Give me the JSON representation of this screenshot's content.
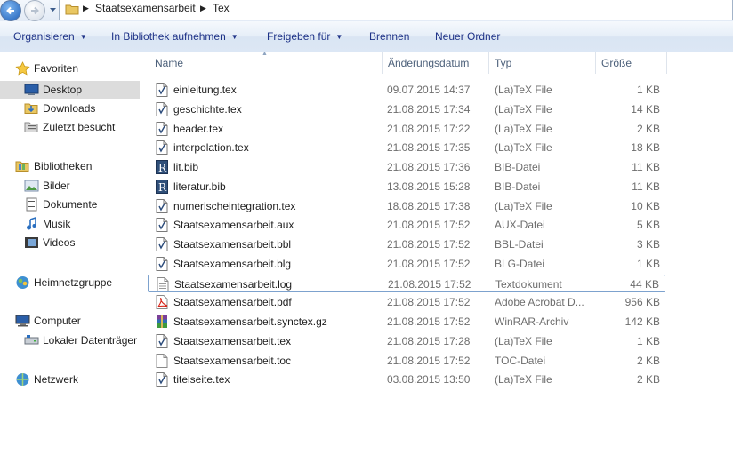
{
  "address": {
    "crumbs": [
      "Staatsexamensarbeit",
      "Tex"
    ]
  },
  "toolbar": {
    "organize": "Organisieren",
    "include_library": "In Bibliothek aufnehmen",
    "share": "Freigeben für",
    "burn": "Brennen",
    "new_folder": "Neuer Ordner"
  },
  "nav": {
    "favorites": "Favoriten",
    "desktop": "Desktop",
    "downloads": "Downloads",
    "recent": "Zuletzt besucht",
    "libraries": "Bibliotheken",
    "pictures": "Bilder",
    "documents": "Dokumente",
    "music": "Musik",
    "videos": "Videos",
    "homegroup": "Heimnetzgruppe",
    "computer": "Computer",
    "local_disk": "Lokaler Datenträger",
    "network": "Netzwerk"
  },
  "columns": {
    "name": "Name",
    "date": "Änderungsdatum",
    "type": "Typ",
    "size": "Größe"
  },
  "files": [
    {
      "name": "einleitung.tex",
      "date": "09.07.2015 14:37",
      "type": "(La)TeX File",
      "size": "1 KB",
      "icon": "tex-file-icon"
    },
    {
      "name": "geschichte.tex",
      "date": "21.08.2015 17:34",
      "type": "(La)TeX File",
      "size": "14 KB",
      "icon": "tex-file-icon"
    },
    {
      "name": "header.tex",
      "date": "21.08.2015 17:22",
      "type": "(La)TeX File",
      "size": "2 KB",
      "icon": "tex-file-icon"
    },
    {
      "name": "interpolation.tex",
      "date": "21.08.2015 17:35",
      "type": "(La)TeX File",
      "size": "18 KB",
      "icon": "tex-file-icon"
    },
    {
      "name": "lit.bib",
      "date": "21.08.2015 17:36",
      "type": "BIB-Datei",
      "size": "11 KB",
      "icon": "bib-file-icon"
    },
    {
      "name": "literatur.bib",
      "date": "13.08.2015 15:28",
      "type": "BIB-Datei",
      "size": "11 KB",
      "icon": "bib-file-icon"
    },
    {
      "name": "numerischeintegration.tex",
      "date": "18.08.2015 17:38",
      "type": "(La)TeX File",
      "size": "10 KB",
      "icon": "tex-file-icon"
    },
    {
      "name": "Staatsexamensarbeit.aux",
      "date": "21.08.2015 17:52",
      "type": "AUX-Datei",
      "size": "5 KB",
      "icon": "tex-file-icon"
    },
    {
      "name": "Staatsexamensarbeit.bbl",
      "date": "21.08.2015 17:52",
      "type": "BBL-Datei",
      "size": "3 KB",
      "icon": "tex-file-icon"
    },
    {
      "name": "Staatsexamensarbeit.blg",
      "date": "21.08.2015 17:52",
      "type": "BLG-Datei",
      "size": "1 KB",
      "icon": "tex-file-icon"
    },
    {
      "name": "Staatsexamensarbeit.log",
      "date": "21.08.2015 17:52",
      "type": "Textdokument",
      "size": "44 KB",
      "icon": "text-file-icon"
    },
    {
      "name": "Staatsexamensarbeit.pdf",
      "date": "21.08.2015 17:52",
      "type": "Adobe Acrobat D...",
      "size": "956 KB",
      "icon": "pdf-file-icon"
    },
    {
      "name": "Staatsexamensarbeit.synctex.gz",
      "date": "21.08.2015 17:52",
      "type": "WinRAR-Archiv",
      "size": "142 KB",
      "icon": "archive-file-icon"
    },
    {
      "name": "Staatsexamensarbeit.tex",
      "date": "21.08.2015 17:28",
      "type": "(La)TeX File",
      "size": "1 KB",
      "icon": "tex-file-icon"
    },
    {
      "name": "Staatsexamensarbeit.toc",
      "date": "21.08.2015 17:52",
      "type": "TOC-Datei",
      "size": "2 KB",
      "icon": "blank-file-icon"
    },
    {
      "name": "titelseite.tex",
      "date": "03.08.2015 13:50",
      "type": "(La)TeX File",
      "size": "2 KB",
      "icon": "tex-file-icon"
    }
  ],
  "focused_file": "Staatsexamensarbeit.log"
}
